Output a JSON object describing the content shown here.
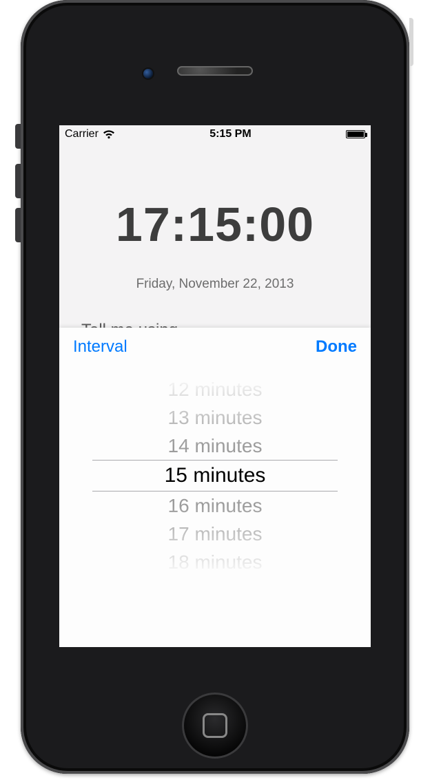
{
  "status": {
    "carrier": "Carrier",
    "time": "5:15 PM"
  },
  "app": {
    "clock": "17:15:00",
    "date": "Friday, November 22, 2013",
    "tell_me_label": "Tell me using"
  },
  "sheet": {
    "title": "Interval",
    "done_label": "Done"
  },
  "picker": {
    "options": [
      "12 minutes",
      "13 minutes",
      "14 minutes",
      "15 minutes",
      "16 minutes",
      "17 minutes",
      "18 minutes"
    ],
    "selected_index": 3
  }
}
